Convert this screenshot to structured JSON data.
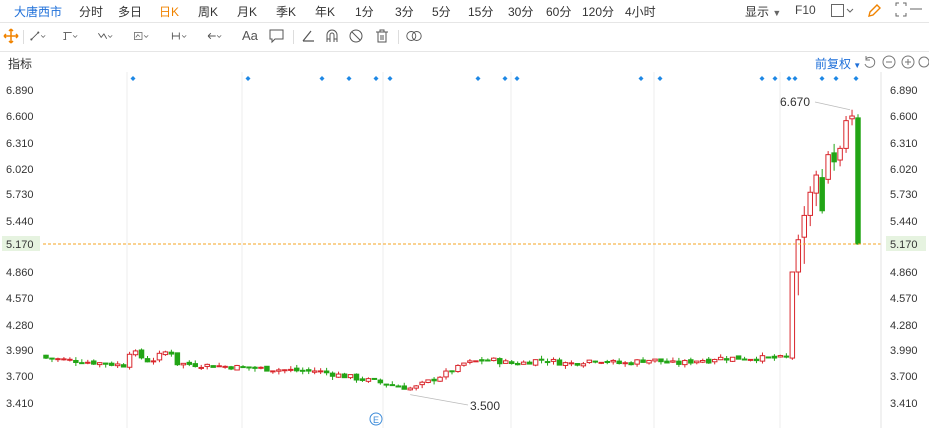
{
  "stock_name": "大唐西市",
  "periods": [
    "分时",
    "多日",
    "日K",
    "周K",
    "月K",
    "季K",
    "年K",
    "1分",
    "3分",
    "5分",
    "15分",
    "30分",
    "60分",
    "120分",
    "4小时"
  ],
  "active_period": "日K",
  "top_right": {
    "display_label": "显示",
    "f10_label": "F10"
  },
  "indicator_label": "指标",
  "fuquan_label": "前复权",
  "tools": [
    "move-icon",
    "line-tool-icon",
    "channel-tool-icon",
    "wave-tool-icon",
    "fib-tool-icon",
    "measure-tool-icon",
    "arrow-tool-icon",
    "text-tool-icon",
    "comment-tool-icon",
    "angle-tool-icon",
    "magnet-icon",
    "hide-icon",
    "delete-icon",
    "link-icon"
  ],
  "text_tool_label": "Aa",
  "colors": {
    "up": "#d9252b",
    "down": "#22a516",
    "accent": "#f08300",
    "marker": "#1e88e5",
    "price_line": "#f5a623"
  },
  "chart_data": {
    "type": "candlestick",
    "y_ticks": [
      "6.890",
      "6.600",
      "6.310",
      "6.020",
      "5.730",
      "5.440",
      "5.170",
      "4.860",
      "4.570",
      "4.280",
      "3.990",
      "3.700",
      "3.410"
    ],
    "ylim": [
      3.3,
      7.0
    ],
    "current_price": "5.170",
    "high_label": "6.670",
    "low_label": "3.500",
    "event_label": "E"
  }
}
